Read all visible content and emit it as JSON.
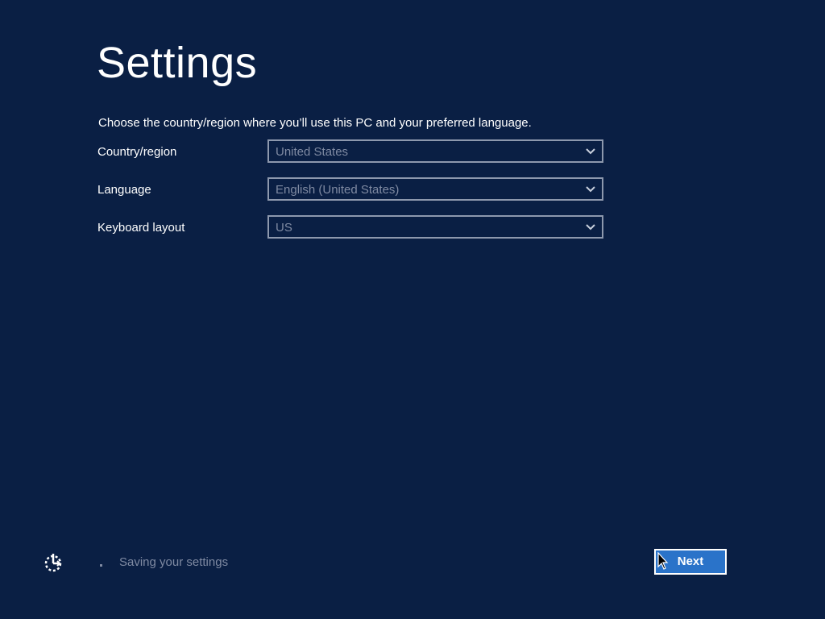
{
  "page": {
    "title": "Settings",
    "instruction": "Choose the country/region where you’ll use this PC and your preferred language."
  },
  "fields": [
    {
      "label": "Country/region",
      "value": "United States"
    },
    {
      "label": "Language",
      "value": "English (United States)"
    },
    {
      "label": "Keyboard layout",
      "value": "US"
    }
  ],
  "footer": {
    "status_text": "Saving your settings",
    "next_label": "Next"
  },
  "icons": {
    "spinner": "accessibility-icon",
    "dropdown": "chevron-down-icon",
    "pointer": "mouse-cursor-icon"
  },
  "colors": {
    "background": "#0a1f44",
    "accent": "#2a73c9",
    "muted_text": "#7f8aa2"
  }
}
